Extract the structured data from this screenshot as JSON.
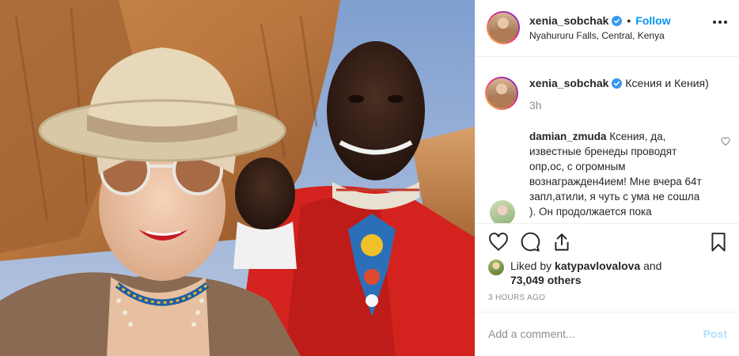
{
  "header": {
    "username": "xenia_sobchak",
    "separator": "•",
    "follow_label": "Follow",
    "location": "Nyahururu Falls, Central, Kenya",
    "more_icon": "more-horizontal-icon"
  },
  "caption": {
    "username": "xenia_sobchak",
    "text": "Ксения и Кения)",
    "time": "3h"
  },
  "comment": {
    "username": "damian_zmuda",
    "text": "Ксения, да, известные бренеды проводят опр,ос, с огромным вознагражден4ием! Мне вчера 64т запл,атили, я чуть с ума не сошла ). Он продолжается пока"
  },
  "actions": {
    "like_icon": "heart-icon",
    "comment_icon": "comment-icon",
    "share_icon": "share-icon",
    "save_icon": "bookmark-icon"
  },
  "likes": {
    "prefix": "Liked by",
    "user": "katypavlovalova",
    "and": "and",
    "others": "73,049 others"
  },
  "timestamp": "3 HOURS AGO",
  "add_comment": {
    "placeholder": "Add a comment...",
    "post_label": "Post"
  },
  "colors": {
    "link_blue": "#0095f6",
    "post_disabled": "#b2dffc",
    "muted": "#8e8e8e",
    "verified": "#3897f0"
  }
}
